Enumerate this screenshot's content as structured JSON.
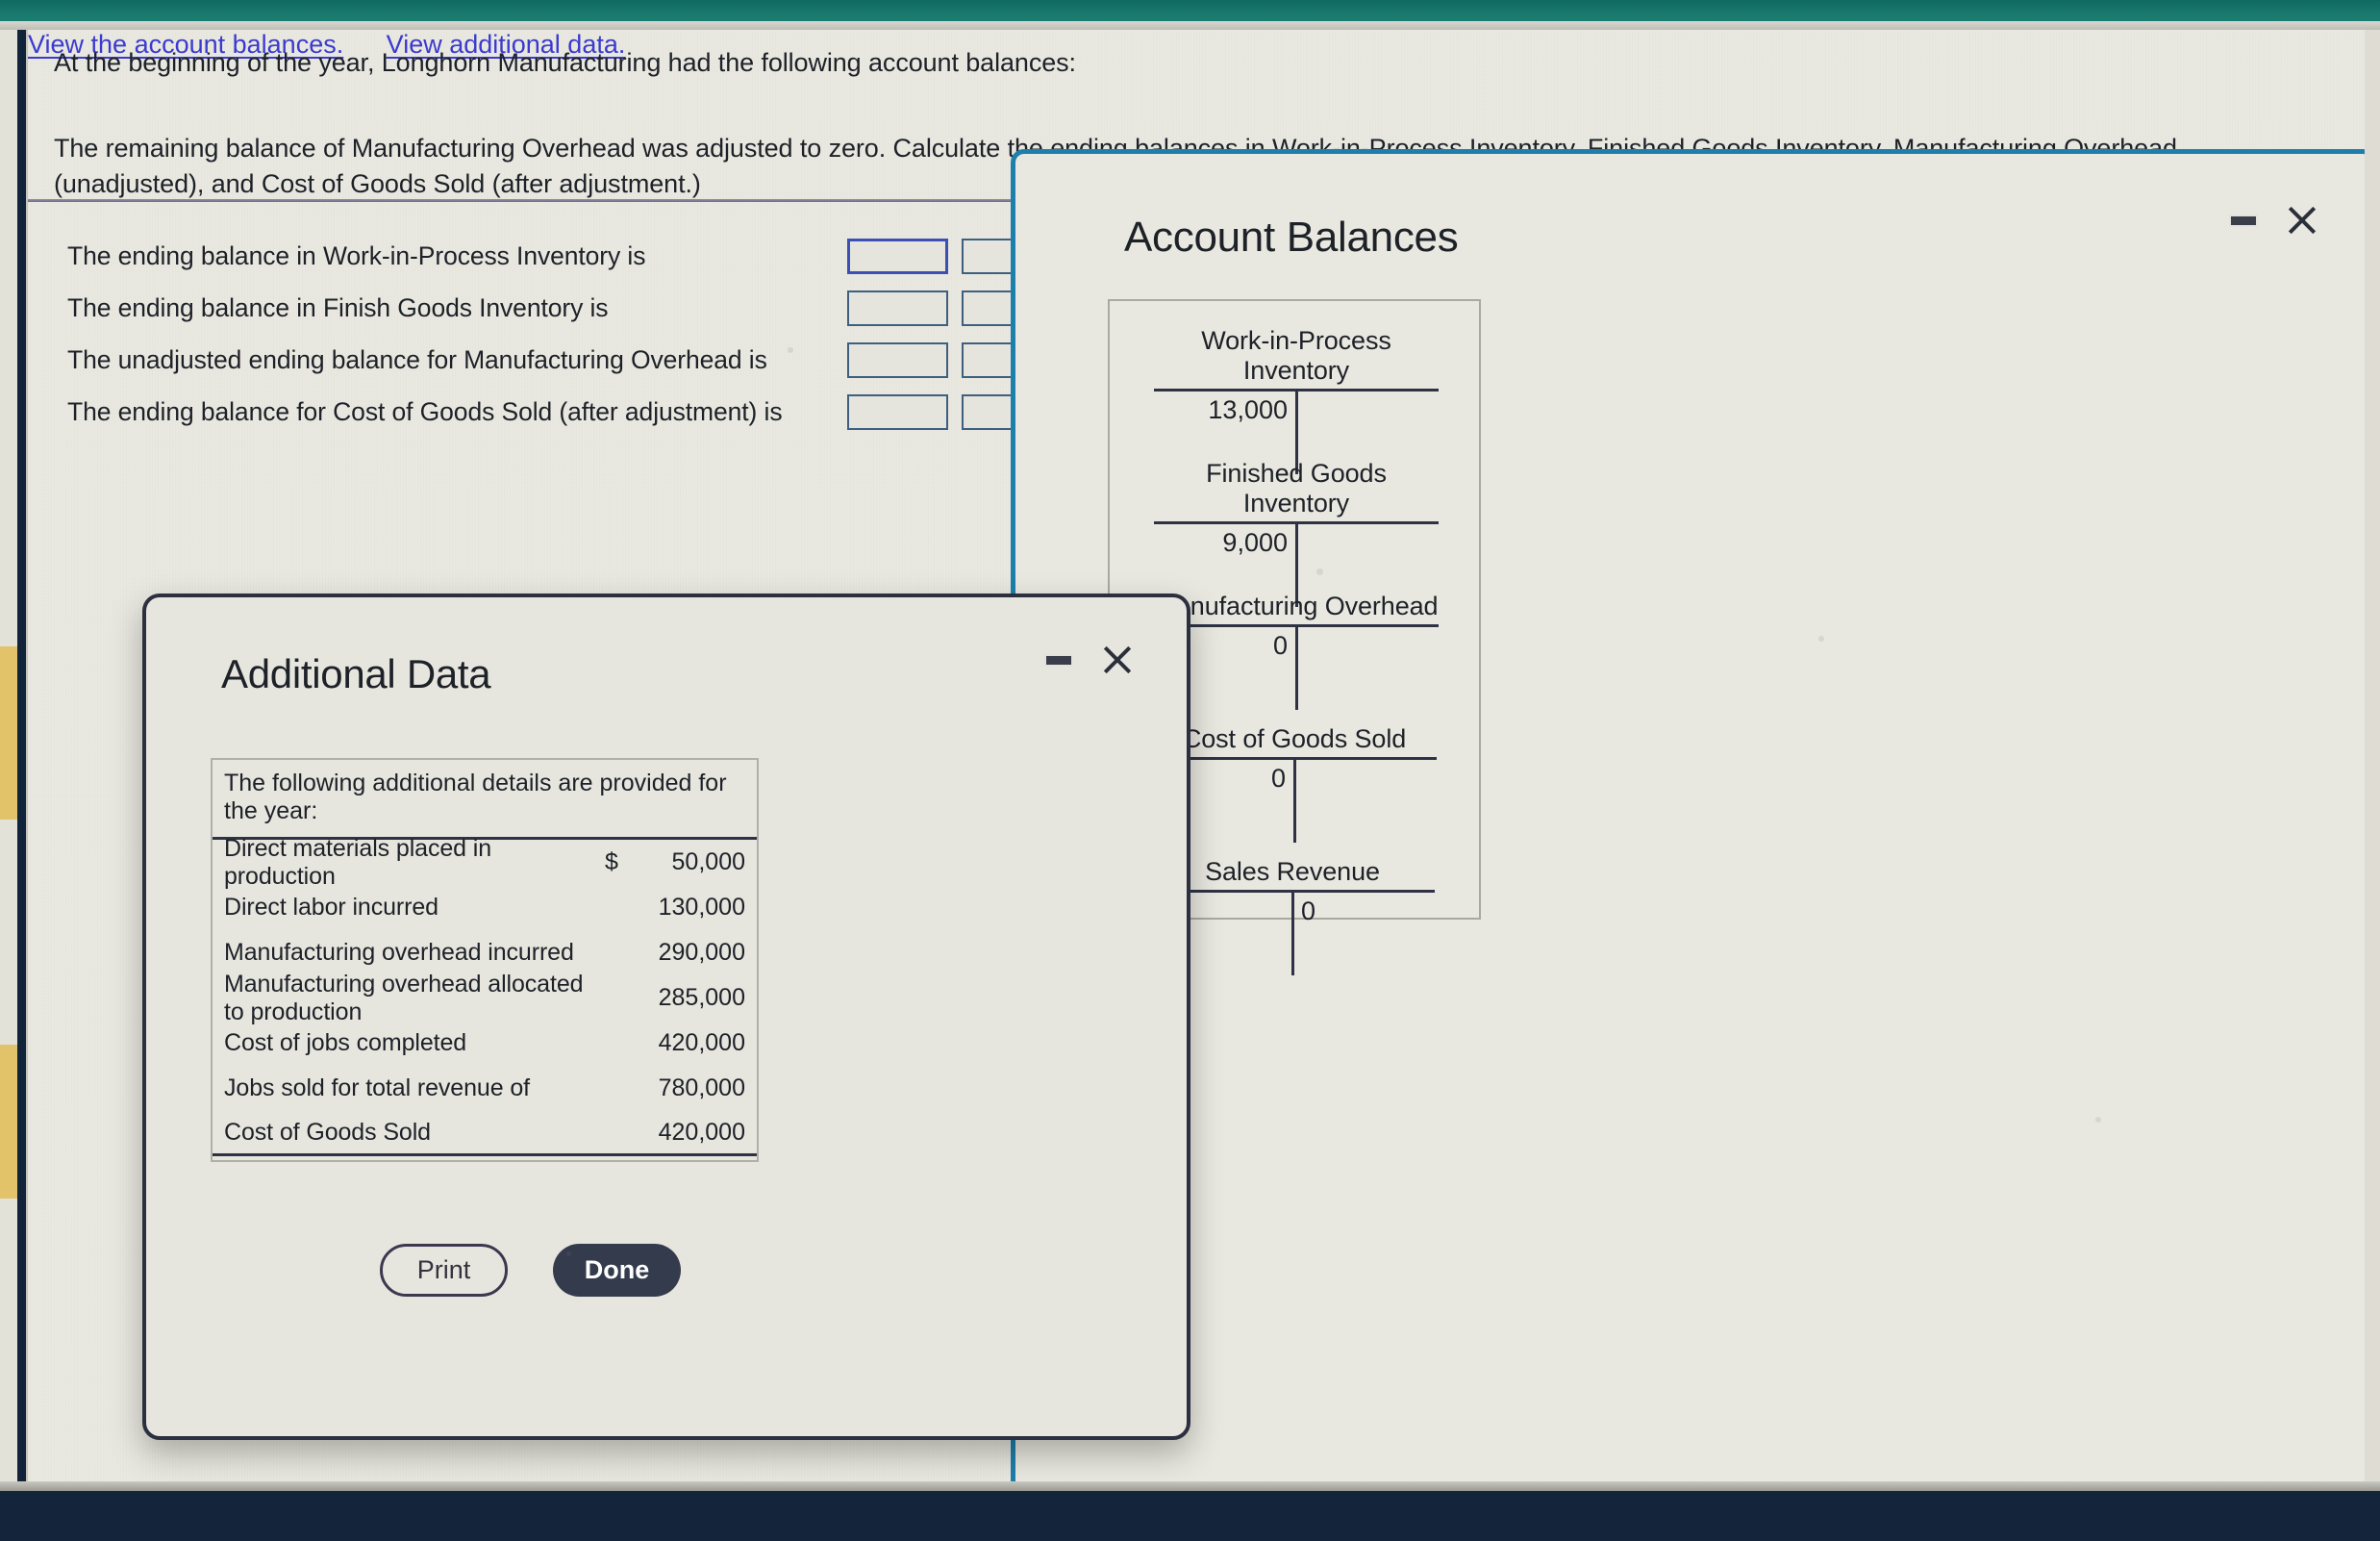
{
  "question": {
    "intro": "At the beginning of the year, Longhorn Manufacturing had the following account balances:",
    "link_account_balances": "View the account balances.",
    "link_additional_data": "View additional data.",
    "body": "The remaining balance of Manufacturing Overhead was adjusted to zero. Calculate the ending balances in Work-in-Process Inventory, Finished Goods Inventory, Manufacturing Overhead (unadjusted), and Cost of Goods Sold (after adjustment.)",
    "more_options": "…"
  },
  "answers": {
    "rows": [
      {
        "label": "The ending balance in Work-in-Process Inventory is",
        "value": "",
        "value2": ""
      },
      {
        "label": "The ending balance in Finish Goods Inventory is",
        "value": "",
        "value2": ""
      },
      {
        "label": "The unadjusted ending balance for Manufacturing Overhead is",
        "value": "",
        "value2": ""
      },
      {
        "label": "The ending balance for Cost of Goods Sold (after adjustment) is",
        "value": "",
        "value2": ""
      }
    ]
  },
  "account_balances_panel": {
    "title": "Account Balances",
    "minimize_label": "minimize",
    "close_label": "close",
    "t_accounts": [
      {
        "name": "Work-in-Process Inventory",
        "debit": "13,000",
        "credit": ""
      },
      {
        "name": "Finished Goods Inventory",
        "debit": "9,000",
        "credit": ""
      },
      {
        "name": "Manufacturing Overhead",
        "debit": "0",
        "credit": ""
      },
      {
        "name": "Cost of Goods Sold",
        "debit": "0",
        "credit": ""
      },
      {
        "name": "Sales Revenue",
        "debit": "",
        "credit": "0"
      }
    ]
  },
  "additional_data_dialog": {
    "title": "Additional Data",
    "minimize_label": "minimize",
    "close_label": "close",
    "table_heading": "The following additional details are provided for the year:",
    "rows": [
      {
        "label": "Direct materials placed in production",
        "currency": "$",
        "value": "50,000"
      },
      {
        "label": "Direct labor incurred",
        "currency": "",
        "value": "130,000"
      },
      {
        "label": "Manufacturing overhead incurred",
        "currency": "",
        "value": "290,000"
      },
      {
        "label": "Manufacturing overhead allocated to production",
        "currency": "",
        "value": "285,000"
      },
      {
        "label": "Cost of jobs completed",
        "currency": "",
        "value": "420,000"
      },
      {
        "label": "Jobs sold for total revenue of",
        "currency": "",
        "value": "780,000"
      },
      {
        "label": "Cost of Goods Sold",
        "currency": "",
        "value": "420,000"
      }
    ],
    "print_label": "Print",
    "done_label": "Done"
  },
  "colors": {
    "header_teal": "#19776c",
    "footer_navy": "#14243a",
    "link_blue": "#3a3ad0",
    "panel_border_blue": "#1e7fac",
    "dialog_border_navy": "#2b2f3f",
    "done_button": "#343b4d",
    "accent_gold": "#e3c36a",
    "input_border": "#3e5f80",
    "input_border_focused": "#3b4fb5"
  }
}
